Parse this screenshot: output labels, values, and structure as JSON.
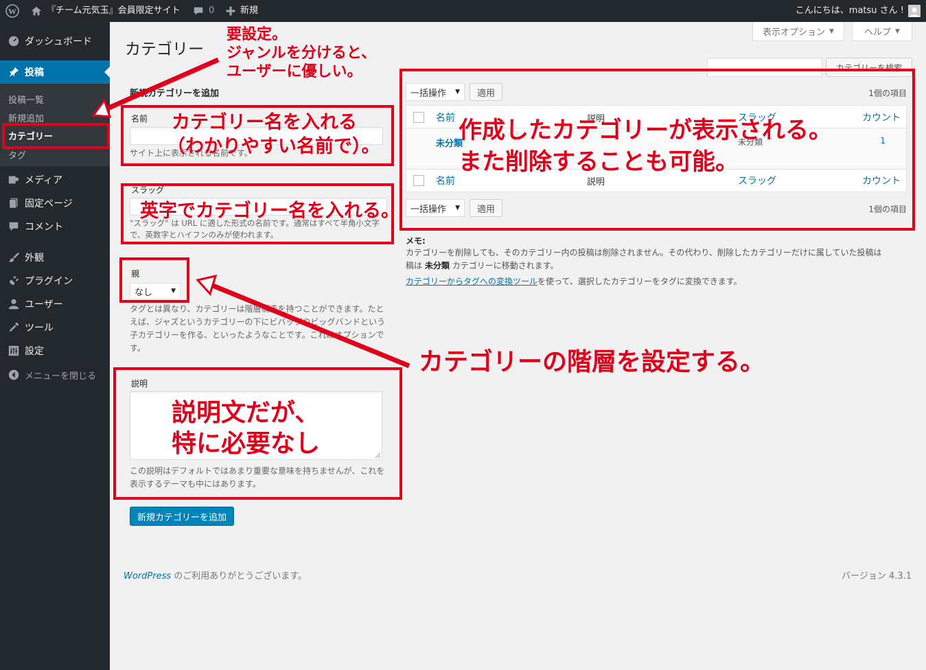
{
  "adminbar": {
    "site_name": "『チーム元気玉』会員限定サイト",
    "comment_count": "0",
    "new_label": "新規",
    "greeting": "こんにちは、matsu さん !"
  },
  "sidebar": {
    "dashboard": "ダッシュボード",
    "posts": "投稿",
    "submenu": {
      "all_posts": "投稿一覧",
      "add_new": "新規追加",
      "categories": "カテゴリー",
      "tags": "タグ"
    },
    "media": "メディア",
    "pages": "固定ページ",
    "comments": "コメント",
    "appearance": "外観",
    "plugins": "プラグイン",
    "users": "ユーザー",
    "tools": "ツール",
    "settings": "設定",
    "collapse": "メニューを閉じる"
  },
  "header": {
    "title": "カテゴリー",
    "screen_options": "表示オプション",
    "help": "ヘルプ",
    "search_button": "カテゴリーを検索"
  },
  "form": {
    "heading": "新規カテゴリーを追加",
    "name_label": "名前",
    "name_value": "",
    "name_help": "サイト上に表示される名前です。",
    "slug_label": "スラッグ",
    "slug_value": "",
    "slug_help": "\"スラッグ\" は URL に適した形式の名前です。通常はすべて半角小文字で、英数字とハイフンのみが使われます。",
    "parent_label": "親",
    "parent_value": "なし",
    "parent_help": "タグとは異なり、カテゴリーは階層構造を持つことができます。たとえば、ジャズというカテゴリーの下にビバップやビッグバンドという子カテゴリーを作る、といったようなことです。これはオプションです。",
    "desc_label": "説明",
    "desc_value": "",
    "desc_help": "この説明はデフォルトではあまり重要な意味を持ちませんが、これを表示するテーマも中にはあります。",
    "submit": "新規カテゴリーを追加"
  },
  "list": {
    "bulk_action": "一括操作",
    "apply": "適用",
    "items_count": "1個の項目",
    "columns": {
      "name": "名前",
      "description": "説明",
      "slug": "スラッグ",
      "count": "カウント"
    },
    "rows": [
      {
        "name": "未分類",
        "description": "",
        "slug": "未分類",
        "count": "1"
      }
    ]
  },
  "memo": {
    "title": "メモ:",
    "line1": "カテゴリーを削除しても、そのカテゴリー内の投稿は削除されません。その代わり、削除したカテゴリーだけに属していた投稿は",
    "line2_bold": "未分類",
    "line2_rest": "カテゴリーに移動されます。",
    "line2_prefix": "稿は",
    "link": "カテゴリーからタグへの変換ツール",
    "line3_rest": "を使って、選択したカテゴリーをタグに変換できます。"
  },
  "footer": {
    "wordpress": "WordPress",
    "thanks": "のご利用ありがとうございます。",
    "version": "バージョン 4.3.1"
  },
  "annotations": {
    "setting_1": "要設定。",
    "setting_2": "ジャンルを分けると、",
    "setting_3": "ユーザーに優しい。",
    "name_1": "カテゴリー名を入れる",
    "name_2": "（わかりやすい名前で）。",
    "slug": "英字でカテゴリー名を入れる。",
    "list_1": "作成したカテゴリーが表示される。",
    "list_2": "また削除することも可能。",
    "parent": "カテゴリーの階層を設定する。",
    "desc_1": "説明文だが、",
    "desc_2": "特に必要なし"
  },
  "colors": {
    "annotation": "#e0001a",
    "admin_dark": "#23282d",
    "accent": "#0073aa"
  }
}
